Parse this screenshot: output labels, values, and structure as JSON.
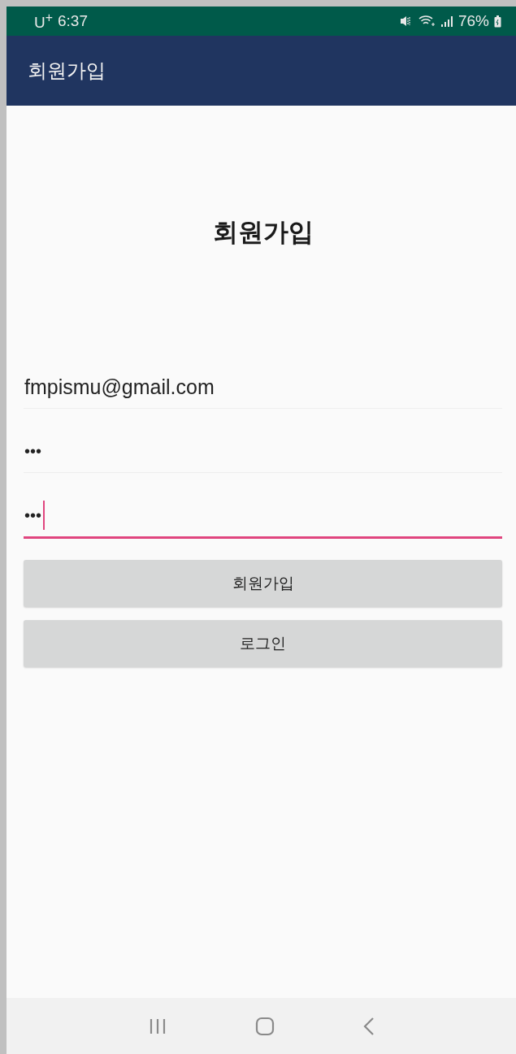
{
  "status_bar": {
    "carrier": "U$^{+}$",
    "time": "6:37",
    "battery": "76%"
  },
  "app_bar": {
    "title": "회원가입"
  },
  "heading": "회원가입",
  "fields": [
    {
      "kind": "email",
      "value": "fmpismu@gmail.com",
      "focused": false
    },
    {
      "kind": "password",
      "value": "•••",
      "focused": false
    },
    {
      "kind": "password",
      "value": "•••",
      "focused": true
    }
  ],
  "buttons": [
    "회원가입",
    "로그인"
  ]
}
